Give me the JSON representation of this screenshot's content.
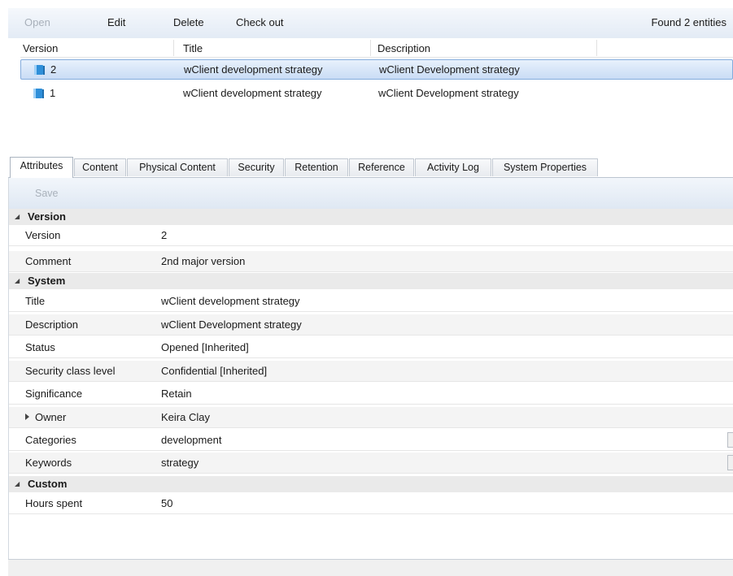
{
  "toolbar": {
    "open_label": "Open",
    "edit_label": "Edit",
    "delete_label": "Delete",
    "checkout_label": "Check out",
    "found_text": "Found 2 entities"
  },
  "grid": {
    "columns": [
      "Version",
      "Title",
      "Description"
    ],
    "rows": [
      {
        "version": "2",
        "title": "wClient development strategy",
        "description": "wClient Development strategy",
        "selected": true
      },
      {
        "version": "1",
        "title": "wClient development strategy",
        "description": "wClient Development strategy",
        "selected": false
      }
    ]
  },
  "tabs": [
    "Attributes",
    "Content",
    "Physical Content",
    "Security",
    "Retention",
    "Reference",
    "Activity Log",
    "System Properties"
  ],
  "active_tab": "Attributes",
  "panel": {
    "save_label": "Save",
    "groups": {
      "version": {
        "title": "Version",
        "rows": [
          {
            "label": "Version",
            "value": "2"
          },
          {
            "label": "Comment",
            "value": "2nd major version"
          }
        ]
      },
      "system": {
        "title": "System",
        "rows": [
          {
            "label": "Title",
            "value": "wClient development strategy"
          },
          {
            "label": "Description",
            "value": "wClient Development strategy"
          },
          {
            "label": "Status",
            "value": "Opened [Inherited]"
          },
          {
            "label": "Security class level",
            "value": "Confidential [Inherited]"
          },
          {
            "label": "Significance",
            "value": "Retain"
          },
          {
            "label": "Owner",
            "value": "Keira Clay"
          },
          {
            "label": "Categories",
            "value": "development"
          },
          {
            "label": "Keywords",
            "value": "strategy"
          }
        ]
      },
      "custom": {
        "title": "Custom",
        "rows": [
          {
            "label": "Hours spent",
            "value": "50"
          }
        ]
      }
    }
  },
  "colors": {
    "selection_border": "#84acdd",
    "toolbar_bg": "#e3ebf5",
    "group_bg": "#eaeaea",
    "icon_blue": "#2f8fd9"
  }
}
